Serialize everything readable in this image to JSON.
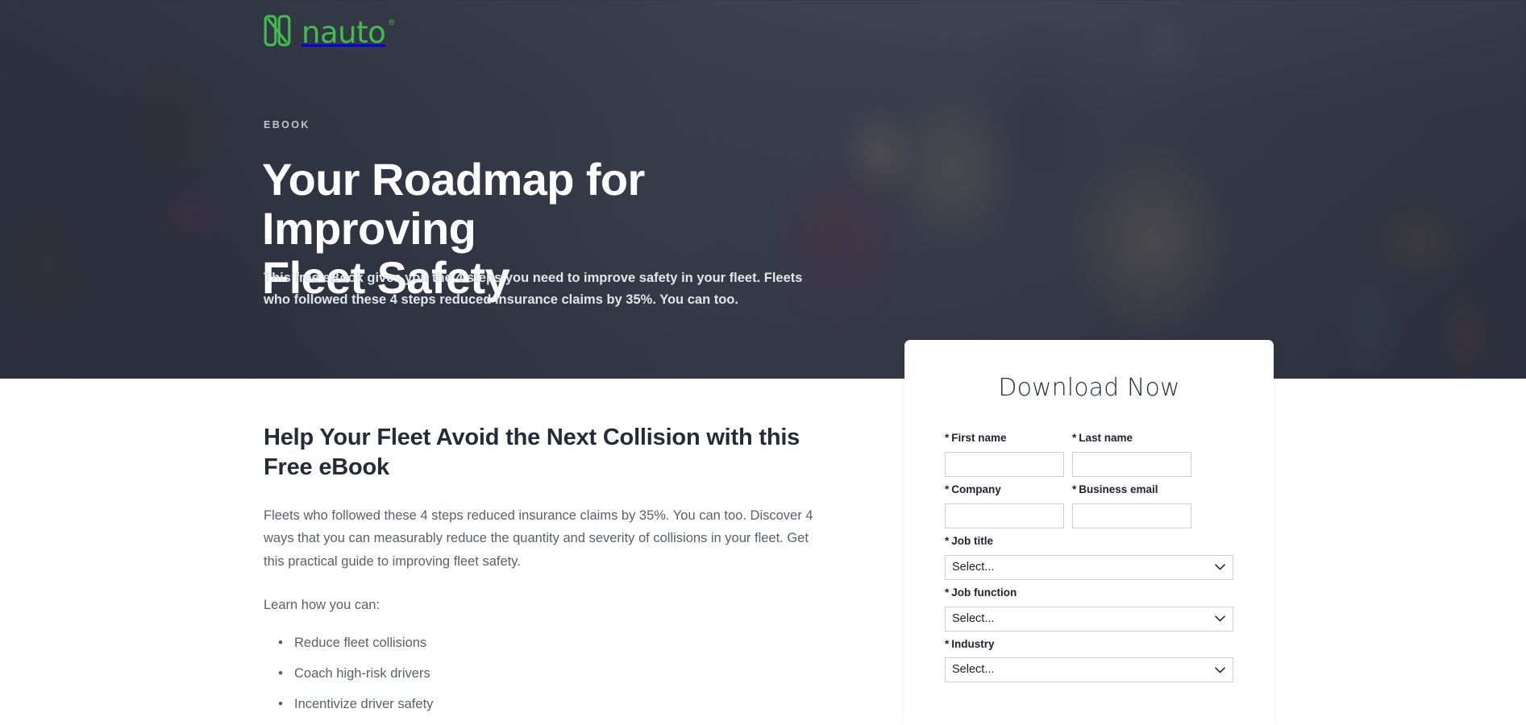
{
  "brand": {
    "name": "nauto",
    "registered_mark": "®",
    "logo_icon": "nauto-n-logomark",
    "green": "#3dbf4e"
  },
  "hero": {
    "eyebrow": "EBOOK",
    "title_line_1": "Your Roadmap for Improving",
    "title_line_2": "Fleet Safety",
    "subtitle": "This free eBook gives you the 4 steps you need to improve safety in your fleet. Fleets who followed these 4 steps reduced insurance claims by 35%. You can too.",
    "overlay_color": "#2a2d3a",
    "background_image": "office-team-meeting-photo"
  },
  "main": {
    "title": "Help Your Fleet Avoid the Next Collision with this Free eBook",
    "paragraph": "Fleets who followed these 4 steps reduced insurance claims by 35%. You can too. Discover 4 ways that you can measurably reduce the quantity and severity of collisions in your fleet. Get this practical guide to improving fleet safety.",
    "list_lead": "Learn how you can:",
    "bullets": [
      "Reduce fleet collisions",
      "Coach high-risk drivers",
      "Incentivize driver safety"
    ]
  },
  "form": {
    "heading": "Download Now",
    "required_marker": "*",
    "select_placeholder": "Select...",
    "chevron_icon": "chevron-down-icon",
    "fields": [
      {
        "label": "First name",
        "type": "text",
        "value": "",
        "name": "first-name"
      },
      {
        "label": "Last name",
        "type": "text",
        "value": "",
        "name": "last-name"
      },
      {
        "label": "Company",
        "type": "text",
        "value": "",
        "name": "company"
      },
      {
        "label": "Business email",
        "type": "text",
        "value": "",
        "name": "business-email"
      },
      {
        "label": "Job title",
        "type": "select",
        "value": "Select...",
        "name": "job-title"
      },
      {
        "label": "Job function",
        "type": "select",
        "value": "Select...",
        "name": "job-function"
      },
      {
        "label": "Industry",
        "type": "select",
        "value": "Select...",
        "name": "industry"
      }
    ]
  }
}
